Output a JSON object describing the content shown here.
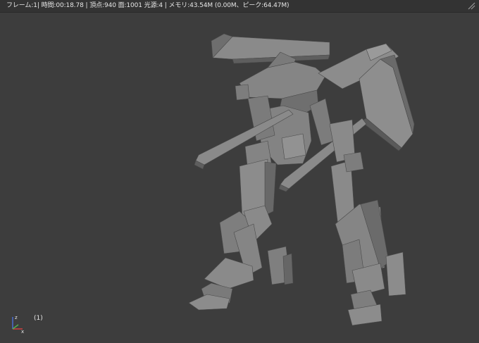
{
  "viewport": {
    "stats_text": "フレーム:1| 時間:00:18.78 | 頂点:940 面:1001 光源:4 | メモリ:43.54M (0.00M、ピーク:64.47M)",
    "frame_label": "(1)"
  },
  "axis_gizmo": {
    "x_color": "#d04040",
    "y_color": "#50b050",
    "z_color": "#4a6cd0"
  },
  "icons": {
    "corner": "viewport-corner-icon",
    "axis": "axis-gizmo-icon"
  },
  "colors": {
    "background": "#3d3d3d",
    "header": "#333333",
    "mesh_light": "#8e8e8e",
    "mesh_mid": "#7a7a7a",
    "mesh_dark": "#5e5e5e",
    "text": "#e6e6e6"
  }
}
